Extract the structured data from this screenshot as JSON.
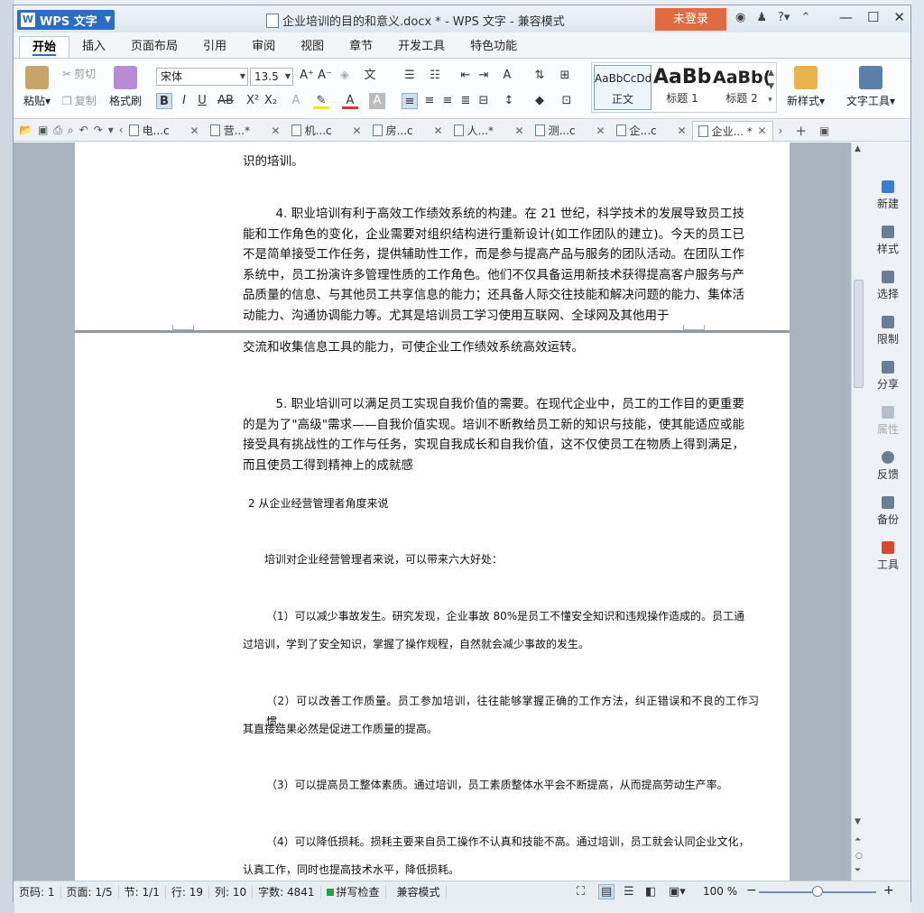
{
  "app": {
    "name": "WPS 文字",
    "doc_title": "企业培训的目的和意义.docx * - WPS 文字 - 兼容模式",
    "login_label": "未登录"
  },
  "ribbon_tabs": [
    "开始",
    "插入",
    "页面布局",
    "引用",
    "审阅",
    "视图",
    "章节",
    "开发工具",
    "特色功能"
  ],
  "ribbon": {
    "paste": "粘贴",
    "cut": "剪切",
    "copy": "复制",
    "format_painter": "格式刷",
    "font_name": "宋体",
    "font_size": "13.5",
    "new_style": "新样式",
    "text_tools": "文字工具",
    "styles": [
      {
        "sample": "AaBbCcDd",
        "name": "正文"
      },
      {
        "sample": "AaBb",
        "name": "标题 1"
      },
      {
        "sample": "AaBb(",
        "name": "标题 2"
      }
    ]
  },
  "doc_tabs": [
    {
      "label": "电...c"
    },
    {
      "label": "营...*"
    },
    {
      "label": "机...c"
    },
    {
      "label": "房...c"
    },
    {
      "label": "人...*"
    },
    {
      "label": "测...c"
    },
    {
      "label": "企...c"
    },
    {
      "label": "企业... *"
    }
  ],
  "document": {
    "p0": "识的培训。",
    "p4": "4. 职业培训有利于高效工作绩效系统的构建。在 21 世纪，科学技术的发展导致员工技能和工作角色的变化，企业需要对组织结构进行重新设计(如工作团队的建立)。今天的员工已不是简单接受工作任务，提供辅助性工作，而是参与提高产品与服务的团队活动。在团队工作系统中，员工扮演许多管理性质的工作角色。他们不仅具备运用新技术获得提高客户服务与产品质量的信息、与其他员工共享信息的能力；还具备人际交往技能和解决问题的能力、集体活动能力、沟通协调能力等。尤其是培训员工学习使用互联网、全球网及其他用于",
    "p4b": "交流和收集信息工具的能力，可使企业工作绩效系统高效运转。",
    "p5": "5. 职业培训可以满足员工实现自我价值的需要。在现代企业中，员工的工作目的更重要的是为了\"高级\"需求——自我价值实现。培训不断教给员工新的知识与技能，使其能适应或能接受具有挑战性的工作与任务，实现自我成长和自我价值，这不仅使员工在物质上得到满足，而且使员工得到精神上的成就感",
    "h2": "2 从企业经营管理者角度来说",
    "intro": "培训对企业经营管理者来说，可以带来六大好处：",
    "b1a": "（1）可以减少事故发生。研究发现，企业事故 80%是员工不懂安全知识和违规操作造成的。员工通",
    "b1b": "过培训，学到了安全知识，掌握了操作规程，自然就会减少事故的发生。",
    "b2a": "（2）可以改善工作质量。员工参加培训，往往能够掌握正确的工作方法，纠正错误和不良的工作习惯，",
    "b2b": "其直接结果必然是促进工作质量的提高。",
    "b3": "（3）可以提高员工整体素质。通过培训，员工素质整体水平会不断提高，从而提高劳动生产率。",
    "b4a": "（4）可以降低损耗。损耗主要来自员工操作不认真和技能不高。通过培训，员工就会认同企业文化，",
    "b4b": "认真工作，同时也提高技术水平，降低损耗。"
  },
  "side_panel": [
    "新建",
    "样式",
    "选择",
    "限制",
    "分享",
    "属性",
    "反馈",
    "备份",
    "工具"
  ],
  "status": {
    "page_no": "页码: 1",
    "pages": "页面: 1/5",
    "section": "节: 1/1",
    "row": "行: 19",
    "col": "列: 10",
    "words": "字数: 4841",
    "spell": "拼写检查",
    "compat": "兼容模式",
    "zoom": "100 %"
  },
  "colors": {
    "brand_blue": "#2a6cc6",
    "login_orange": "#e06a42"
  }
}
